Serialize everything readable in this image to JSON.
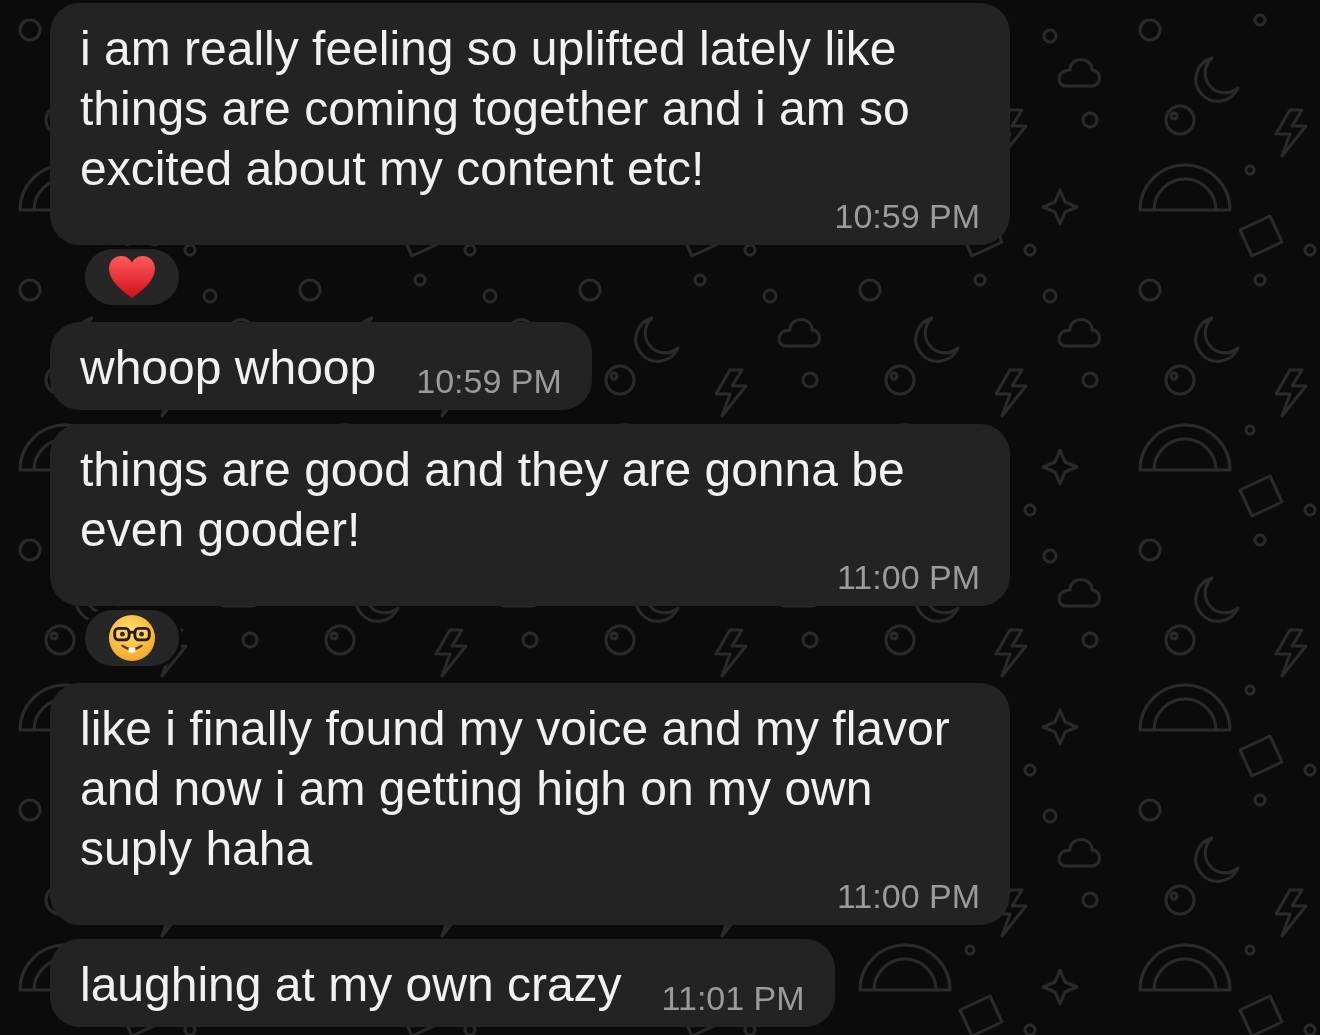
{
  "messages": [
    {
      "text": "i am really feeling so uplifted lately like things are coming together and i am so excited about my content etc!",
      "time": "10:59 PM",
      "reactions": [
        {
          "kind": "heart"
        }
      ]
    },
    {
      "text": "whoop whoop",
      "time": "10:59 PM"
    },
    {
      "text": "things are good and they are gonna be even gooder!",
      "time": "11:00 PM",
      "reactions": [
        {
          "kind": "nerd_face"
        }
      ]
    },
    {
      "text": "like i finally found my voice and my flavor and now i am getting high on my own suply haha",
      "time": "11:00 PM"
    },
    {
      "text": "laughing at my own crazy",
      "time": "11:01 PM"
    }
  ]
}
